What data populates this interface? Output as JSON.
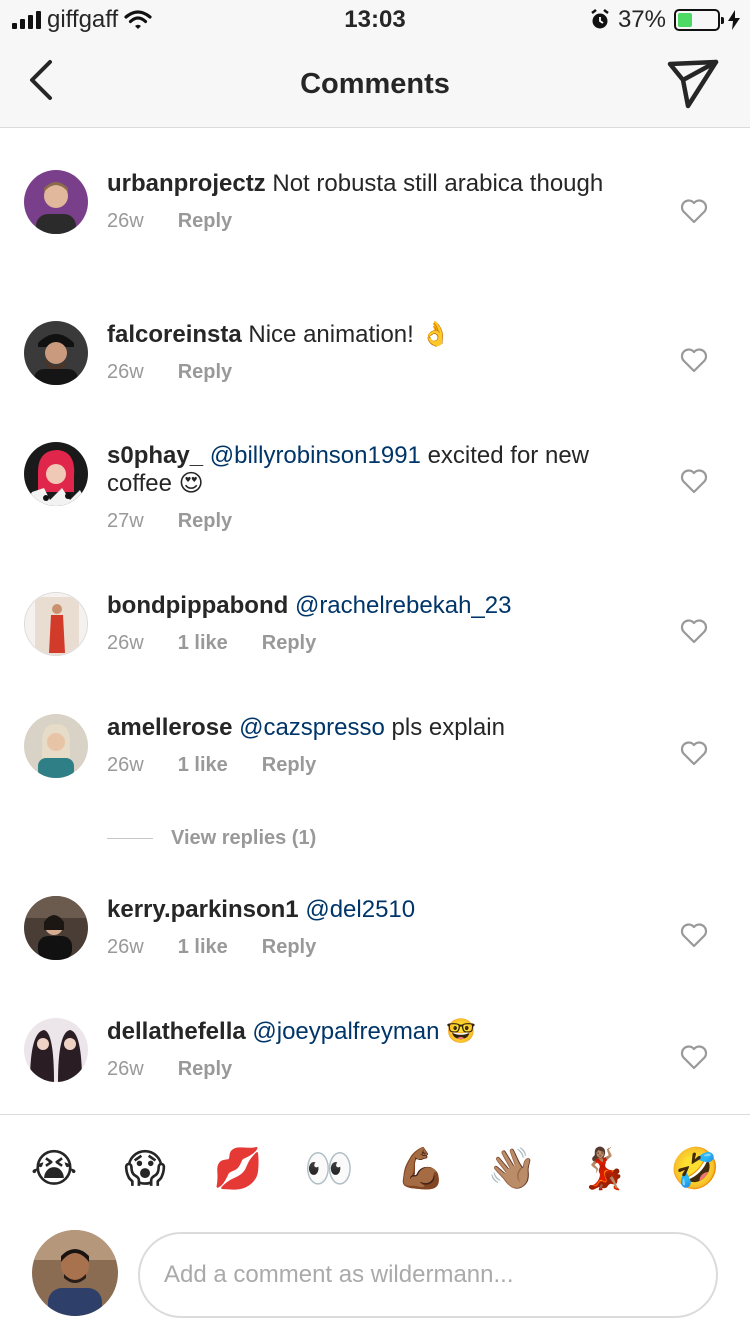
{
  "status_bar": {
    "carrier": "giffgaff",
    "time": "13:03",
    "battery": "37%",
    "battery_level": 0.37
  },
  "header": {
    "title": "Comments",
    "back_icon": "chevron-left-icon",
    "send_icon": "paper-plane-icon"
  },
  "comments": [
    {
      "user": "urbanprojectz",
      "mention": "",
      "text": "Not robusta still arabica though",
      "time": "26w",
      "likes": "",
      "reply": "Reply"
    },
    {
      "user": "falcoreinsta",
      "mention": "",
      "text": "Nice animation! 👌",
      "time": "26w",
      "likes": "",
      "reply": "Reply"
    },
    {
      "user": "s0phay_",
      "mention": "@billyrobinson1991",
      "text": "excited for new coffee 😍",
      "time": "27w",
      "likes": "",
      "reply": "Reply"
    },
    {
      "user": "bondpippabond",
      "mention": "@rachelrebekah_23",
      "text": "",
      "time": "26w",
      "likes": "1 like",
      "reply": "Reply"
    },
    {
      "user": "amellerose",
      "mention": "@cazspresso",
      "text": "pls explain",
      "time": "26w",
      "likes": "1 like",
      "reply": "Reply"
    },
    {
      "user": "kerry.parkinson1",
      "mention": "@del2510",
      "text": "",
      "time": "26w",
      "likes": "1 like",
      "reply": "Reply"
    },
    {
      "user": "dellathefella",
      "mention": "@joeypalfreyman",
      "text": "🤓",
      "time": "26w",
      "likes": "",
      "reply": "Reply"
    }
  ],
  "view_replies": "View replies (1)",
  "emoji_bar": [
    "😭",
    "😱",
    "💋",
    "👀",
    "💪🏾",
    "👋🏽",
    "💃🏽",
    "🤣"
  ],
  "composer": {
    "placeholder": "Add a comment as wildermann..."
  },
  "colors": {
    "mention": "#003569",
    "meta": "#999999",
    "text": "#262626",
    "battery": "#4cd964"
  }
}
